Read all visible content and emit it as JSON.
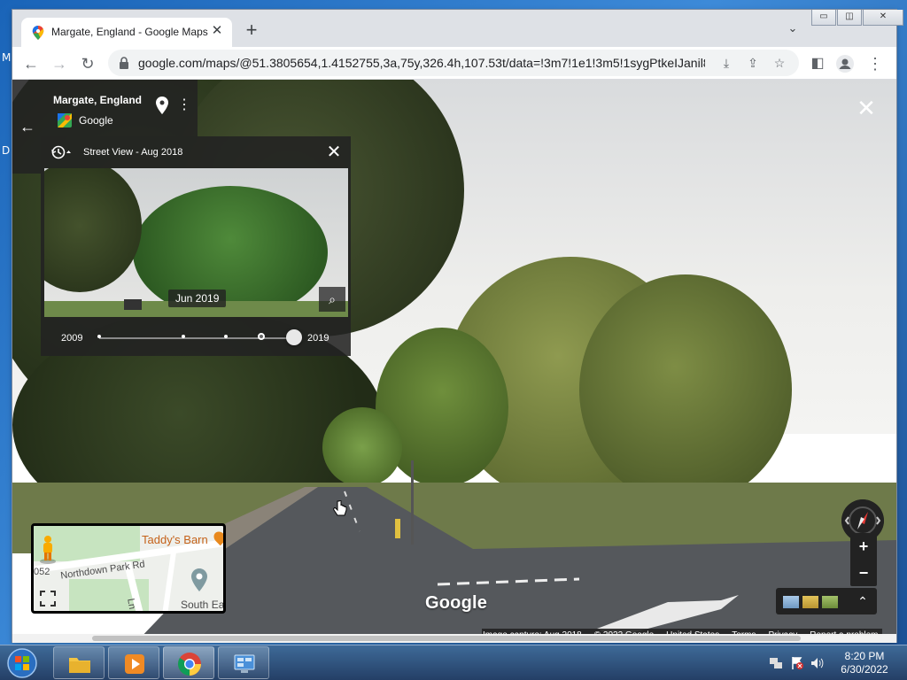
{
  "desktop": {
    "fragment_1": "M",
    "fragment_2": "D"
  },
  "browser": {
    "tab_title": "Margate, England - Google Maps",
    "url": "google.com/maps/@51.3805654,1.4152755,3a,75y,326.4h,107.53t/data=!3m7!1e1!3m5!1sygPtkeIJanil8..."
  },
  "street_view": {
    "place_title": "Margate, England",
    "attribution": "Google",
    "watermark": "Google",
    "time_travel": {
      "label": "Street View - Aug 2018",
      "preview_date": "Jun 2019",
      "year_start": "2009",
      "year_end": "2019",
      "selected_fraction": 1.0,
      "available_points": [
        0.0,
        0.43,
        0.65,
        0.83,
        1.0
      ]
    },
    "minimap": {
      "poi": "Taddy's Barn",
      "road": "Northdown Park Rd",
      "area": "South Ea",
      "num_fragment": "052",
      "lane_fragment": "Ln"
    },
    "footer": [
      "Image capture: Aug 2018",
      "© 2022 Google",
      "United States",
      "Terms",
      "Privacy",
      "Report a problem"
    ]
  },
  "taskbar": {
    "time": "8:20 PM",
    "date": "6/30/2022"
  },
  "colors": {
    "panel_bg": "#222222",
    "accent_orange": "#e8891d",
    "chrome_tab_bg": "#dee1e6"
  }
}
